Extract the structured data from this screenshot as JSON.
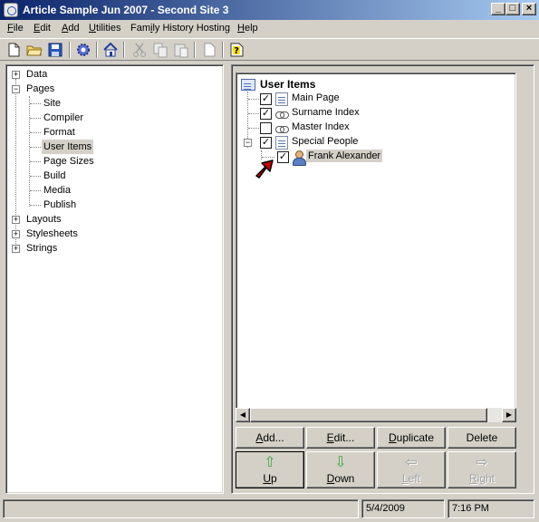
{
  "window": {
    "title": "Article Sample Jun 2007 - Second Site 3",
    "controls": {
      "minimize": "_",
      "maximize": "□",
      "close": "×"
    }
  },
  "menu": [
    {
      "pre": "",
      "u": "F",
      "post": "ile"
    },
    {
      "pre": "",
      "u": "E",
      "post": "dit"
    },
    {
      "pre": "",
      "u": "A",
      "post": "dd"
    },
    {
      "pre": "",
      "u": "U",
      "post": "tilities"
    },
    {
      "pre": "Fam",
      "u": "i",
      "post": "ly History Hosting"
    },
    {
      "pre": "",
      "u": "H",
      "post": "elp"
    }
  ],
  "toolbar": {
    "icons": [
      "new-file-icon",
      "open-folder-icon",
      "save-icon",
      "settings-gear-icon",
      "home-icon",
      "cut-icon",
      "copy-icon",
      "paste-icon",
      "blank-page-icon",
      "help-icon"
    ]
  },
  "left_tree": {
    "nodes": [
      "Data",
      "Pages",
      "Site",
      "Compiler",
      "Format",
      "User Items",
      "Page Sizes",
      "Build",
      "Media",
      "Publish",
      "Layouts",
      "Stylesheets",
      "Strings"
    ]
  },
  "user_items": {
    "root": "User Items",
    "items": [
      {
        "label": "Main Page",
        "checked": true,
        "icon": "document-icon"
      },
      {
        "label": "Surname Index",
        "checked": true,
        "icon": "link-icon"
      },
      {
        "label": "Master Index",
        "checked": false,
        "icon": "link-icon"
      },
      {
        "label": "Special People",
        "checked": true,
        "icon": "document-icon"
      },
      {
        "label": "Frank Alexander",
        "checked": true,
        "icon": "person-icon"
      }
    ]
  },
  "buttons": {
    "add": {
      "u": "A",
      "post": "dd..."
    },
    "edit": {
      "u": "E",
      "post": "dit..."
    },
    "duplicate": {
      "u": "D",
      "post": "uplicate"
    },
    "delete": "Delete",
    "up": {
      "u": "U",
      "post": "p"
    },
    "down": {
      "u": "D",
      "post": "own"
    },
    "left": {
      "u": "L",
      "post": "eft"
    },
    "right": {
      "u": "R",
      "post": "ight"
    }
  },
  "status": {
    "message": "",
    "date": "5/4/2009",
    "time": "7:16 PM"
  },
  "colors": {
    "titlebar_start": "#0a246a",
    "titlebar_end": "#a6caf0",
    "face": "#d4d0c8",
    "pointer_arrow": "#cc0000",
    "up_down_arrow": "#3aa63a"
  }
}
